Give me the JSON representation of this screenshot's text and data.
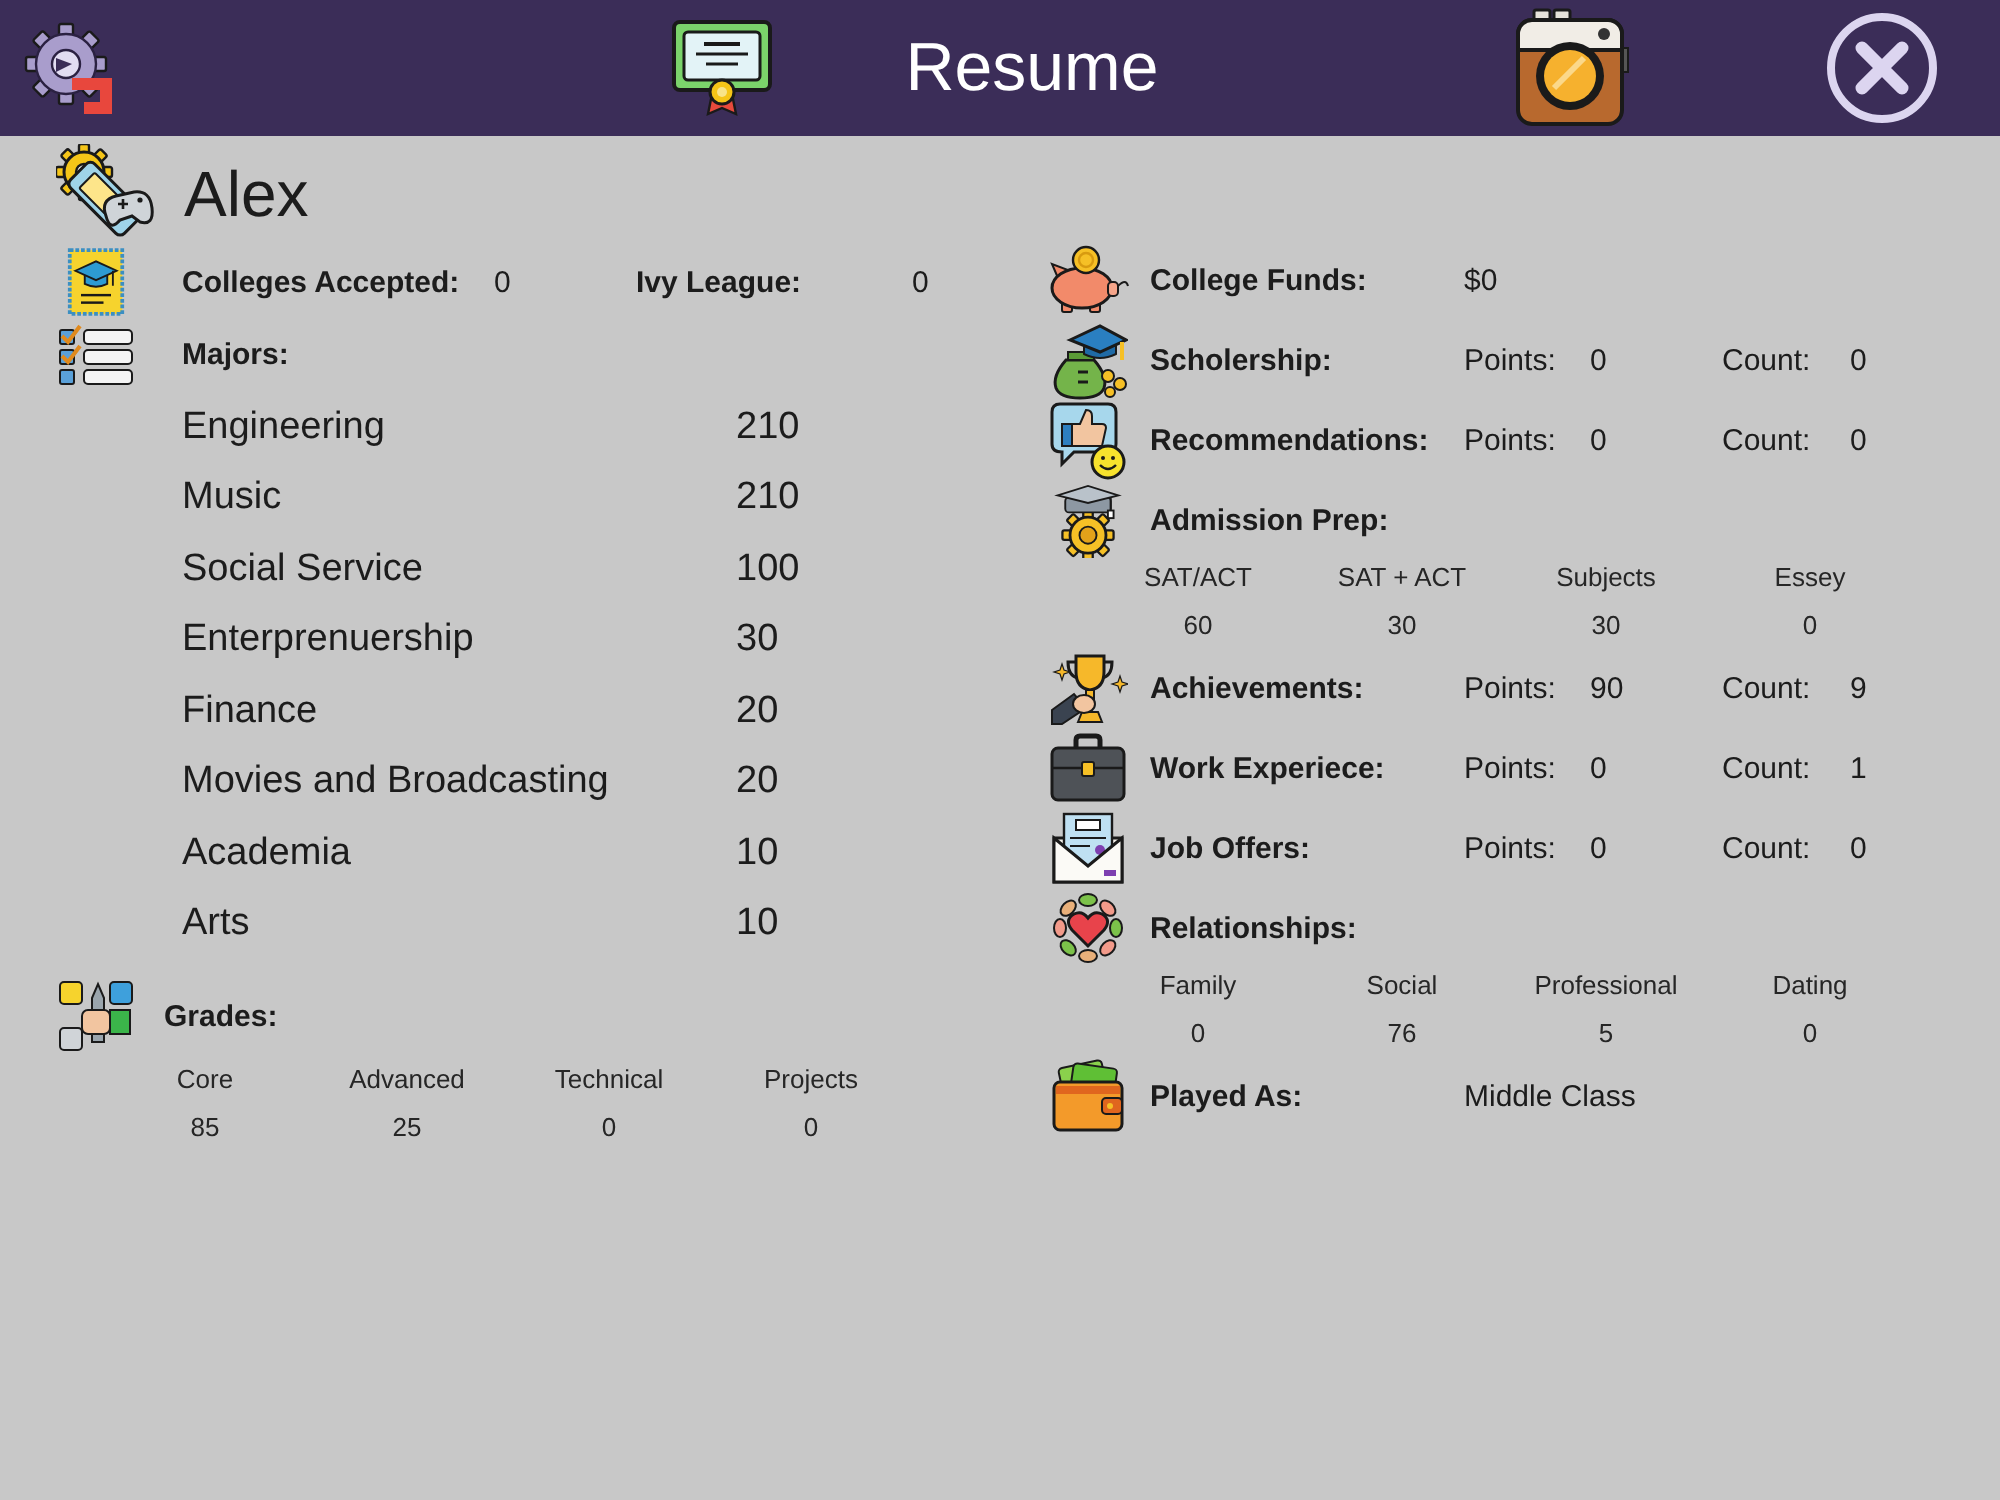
{
  "header": {
    "title": "Resume"
  },
  "profile": {
    "name": "Alex"
  },
  "colleges": {
    "accepted": {
      "label": "Colleges Accepted:",
      "value": "0"
    },
    "ivy_league": {
      "label": "Ivy League:",
      "value": "0"
    }
  },
  "majors": {
    "label": "Majors:",
    "items": [
      {
        "name": "Engineering",
        "score": "210"
      },
      {
        "name": "Music",
        "score": "210"
      },
      {
        "name": "Social Service",
        "score": "100"
      },
      {
        "name": "Enterprenuership",
        "score": "30"
      },
      {
        "name": "Finance",
        "score": "20"
      },
      {
        "name": "Movies and Broadcasting",
        "score": "20"
      },
      {
        "name": "Academia",
        "score": "10"
      },
      {
        "name": "Arts",
        "score": "10"
      }
    ]
  },
  "grades": {
    "label": "Grades:",
    "columns": [
      {
        "label": "Core",
        "value": "85"
      },
      {
        "label": "Advanced",
        "value": "25"
      },
      {
        "label": "Technical",
        "value": "0"
      },
      {
        "label": "Projects",
        "value": "0"
      }
    ]
  },
  "records": [
    {
      "kind": "value",
      "label": "College Funds:",
      "value": "$0"
    },
    {
      "kind": "points_count",
      "label": "Scholership:",
      "points_label": "Points:",
      "points": "0",
      "count_label": "Count:",
      "count": "0"
    },
    {
      "kind": "points_count",
      "label": "Recommendations:",
      "points_label": "Points:",
      "points": "0",
      "count_label": "Count:",
      "count": "0"
    },
    {
      "kind": "breakdown",
      "label": "Admission Prep:",
      "columns": [
        {
          "label": "SAT/ACT",
          "value": "60"
        },
        {
          "label": "SAT + ACT",
          "value": "30"
        },
        {
          "label": "Subjects",
          "value": "30"
        },
        {
          "label": "Essey",
          "value": "0"
        }
      ]
    },
    {
      "kind": "points_count",
      "label": "Achievements:",
      "points_label": "Points:",
      "points": "90",
      "count_label": "Count:",
      "count": "9"
    },
    {
      "kind": "points_count",
      "label": "Work Experiece:",
      "points_label": "Points:",
      "points": "0",
      "count_label": "Count:",
      "count": "1"
    },
    {
      "kind": "points_count",
      "label": "Job Offers:",
      "points_label": "Points:",
      "points": "0",
      "count_label": "Count:",
      "count": "0"
    },
    {
      "kind": "breakdown",
      "label": "Relationships:",
      "columns": [
        {
          "label": "Family",
          "value": "0"
        },
        {
          "label": "Social",
          "value": "76"
        },
        {
          "label": "Professional",
          "value": "5"
        },
        {
          "label": "Dating",
          "value": "0"
        }
      ]
    },
    {
      "kind": "value",
      "label": "Played As:",
      "value": "Middle Class"
    }
  ]
}
